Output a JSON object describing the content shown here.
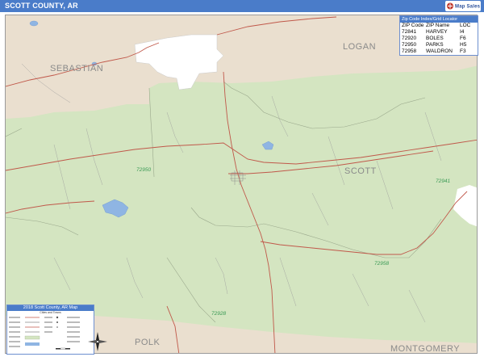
{
  "header": {
    "title": "SCOTT COUNTY, AR",
    "logo_text": "Map Sales"
  },
  "map": {
    "colors": {
      "county_fill": "#d4e5c1",
      "outside_fill": "#eadfcf",
      "roads": "#c0584a",
      "streets": "#8a8a8a",
      "water": "#8fb5e3",
      "zip_boundary": "#9aa88c",
      "city_fill": "#ffffff"
    },
    "county_labels": {
      "sebastian": "SEBASTIAN",
      "logan": "LOGAN",
      "scott": "SCOTT",
      "polk": "POLK",
      "montgomery": "MONTGOMERY"
    },
    "zip_labels": {
      "z72950": "72950",
      "z72941": "72941",
      "z72958": "72958",
      "z72928": "72928"
    }
  },
  "zip_table": {
    "header": "Zip Code Index/Grid Locator",
    "columns": [
      "ZIP Code",
      "ZIP Name",
      "LOC"
    ],
    "rows": [
      [
        "72841",
        "HARVEY",
        "I4"
      ],
      [
        "72920",
        "BOLES",
        "F6"
      ],
      [
        "72950",
        "PARKS",
        "H5"
      ],
      [
        "72958",
        "WALDRON",
        "F3"
      ]
    ]
  },
  "legend": {
    "title": "2018 Scott County, AR Map",
    "subtitle": "Cities and Towns"
  }
}
